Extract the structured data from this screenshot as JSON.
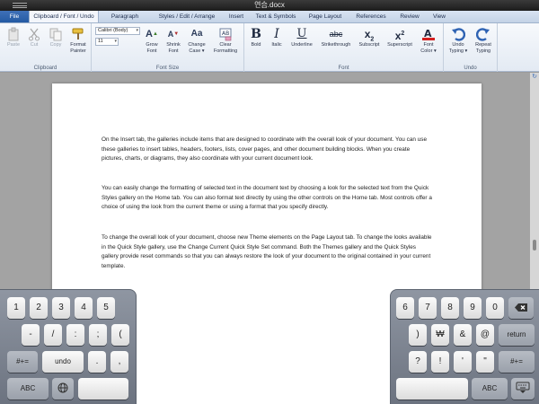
{
  "window": {
    "title": "연습.docx"
  },
  "ribbon_tabs": [
    "File",
    "Clipboard / Font / Undo",
    "Paragraph",
    "Styles / Edit / Arrange",
    "Insert",
    "Text & Symbols",
    "Page Layout",
    "References",
    "Review",
    "View"
  ],
  "clipboard": {
    "label": "Clipboard",
    "paste": "Paste",
    "cut": "Cut",
    "copy": "Copy",
    "format_painter_1": "Format",
    "format_painter_2": "Painter"
  },
  "font_size_group": {
    "label": "Font Size",
    "font_name": "Calibri (Body)",
    "font_size": "11",
    "grow_1": "Grow",
    "grow_2": "Font",
    "shrink_1": "Shrink",
    "shrink_2": "Font",
    "change_case_1": "Change",
    "change_case_2": "Case",
    "clear_1": "Clear",
    "clear_2": "Formatting"
  },
  "font_group": {
    "label": "Font",
    "bold": "Bold",
    "italic": "Italic",
    "underline": "Underline",
    "strikethrough": "Strikethrough",
    "subscript": "Subscript",
    "superscript": "Superscript",
    "font_color_1": "Font",
    "font_color_2": "Color",
    "font_color_value": "#d42020"
  },
  "undo_group": {
    "label": "Undo",
    "undo_1": "Undo",
    "undo_2": "Typing",
    "repeat_1": "Repeat",
    "repeat_2": "Typing"
  },
  "document": {
    "paragraphs": [
      "On the Insert tab, the galleries include items that are designed to coordinate with the overall look of your document. You can use these galleries to insert tables, headers, footers, lists, cover pages, and other document building blocks. When you create pictures, charts, or diagrams, they also coordinate with your current document look.",
      "You can easily change the formatting of selected text in the document text by choosing a look for the selected text from the Quick Styles gallery on the Home tab. You can also format text directly by using the other controls on the Home tab. Most controls offer a choice of using the look from the current theme or using a format that you specify directly.",
      "To change the overall look of your document, choose new Theme elements on the Page Layout tab. To change the looks available in the Quick Style gallery, use the Change Current Quick Style Set command. Both the Themes gallery and the Quick Styles gallery provide reset commands so that you can always restore the look of your document to the original contained in your current template."
    ]
  },
  "keyboard_left": {
    "row1": [
      "1",
      "2",
      "3",
      "4",
      "5"
    ],
    "row2": [
      "-",
      "/",
      ":",
      ";",
      "("
    ],
    "row3": [
      "#+=",
      "undo",
      ".",
      ","
    ],
    "row4": [
      "ABC",
      "",
      ""
    ]
  },
  "keyboard_right": {
    "row1": [
      "6",
      "7",
      "8",
      "9",
      "0"
    ],
    "row2": [
      ")",
      "₩",
      "&",
      "@",
      "return"
    ],
    "row3": [
      "?",
      "!",
      "'",
      "\"",
      "#+="
    ],
    "row4": [
      "",
      "ABC",
      ""
    ]
  }
}
